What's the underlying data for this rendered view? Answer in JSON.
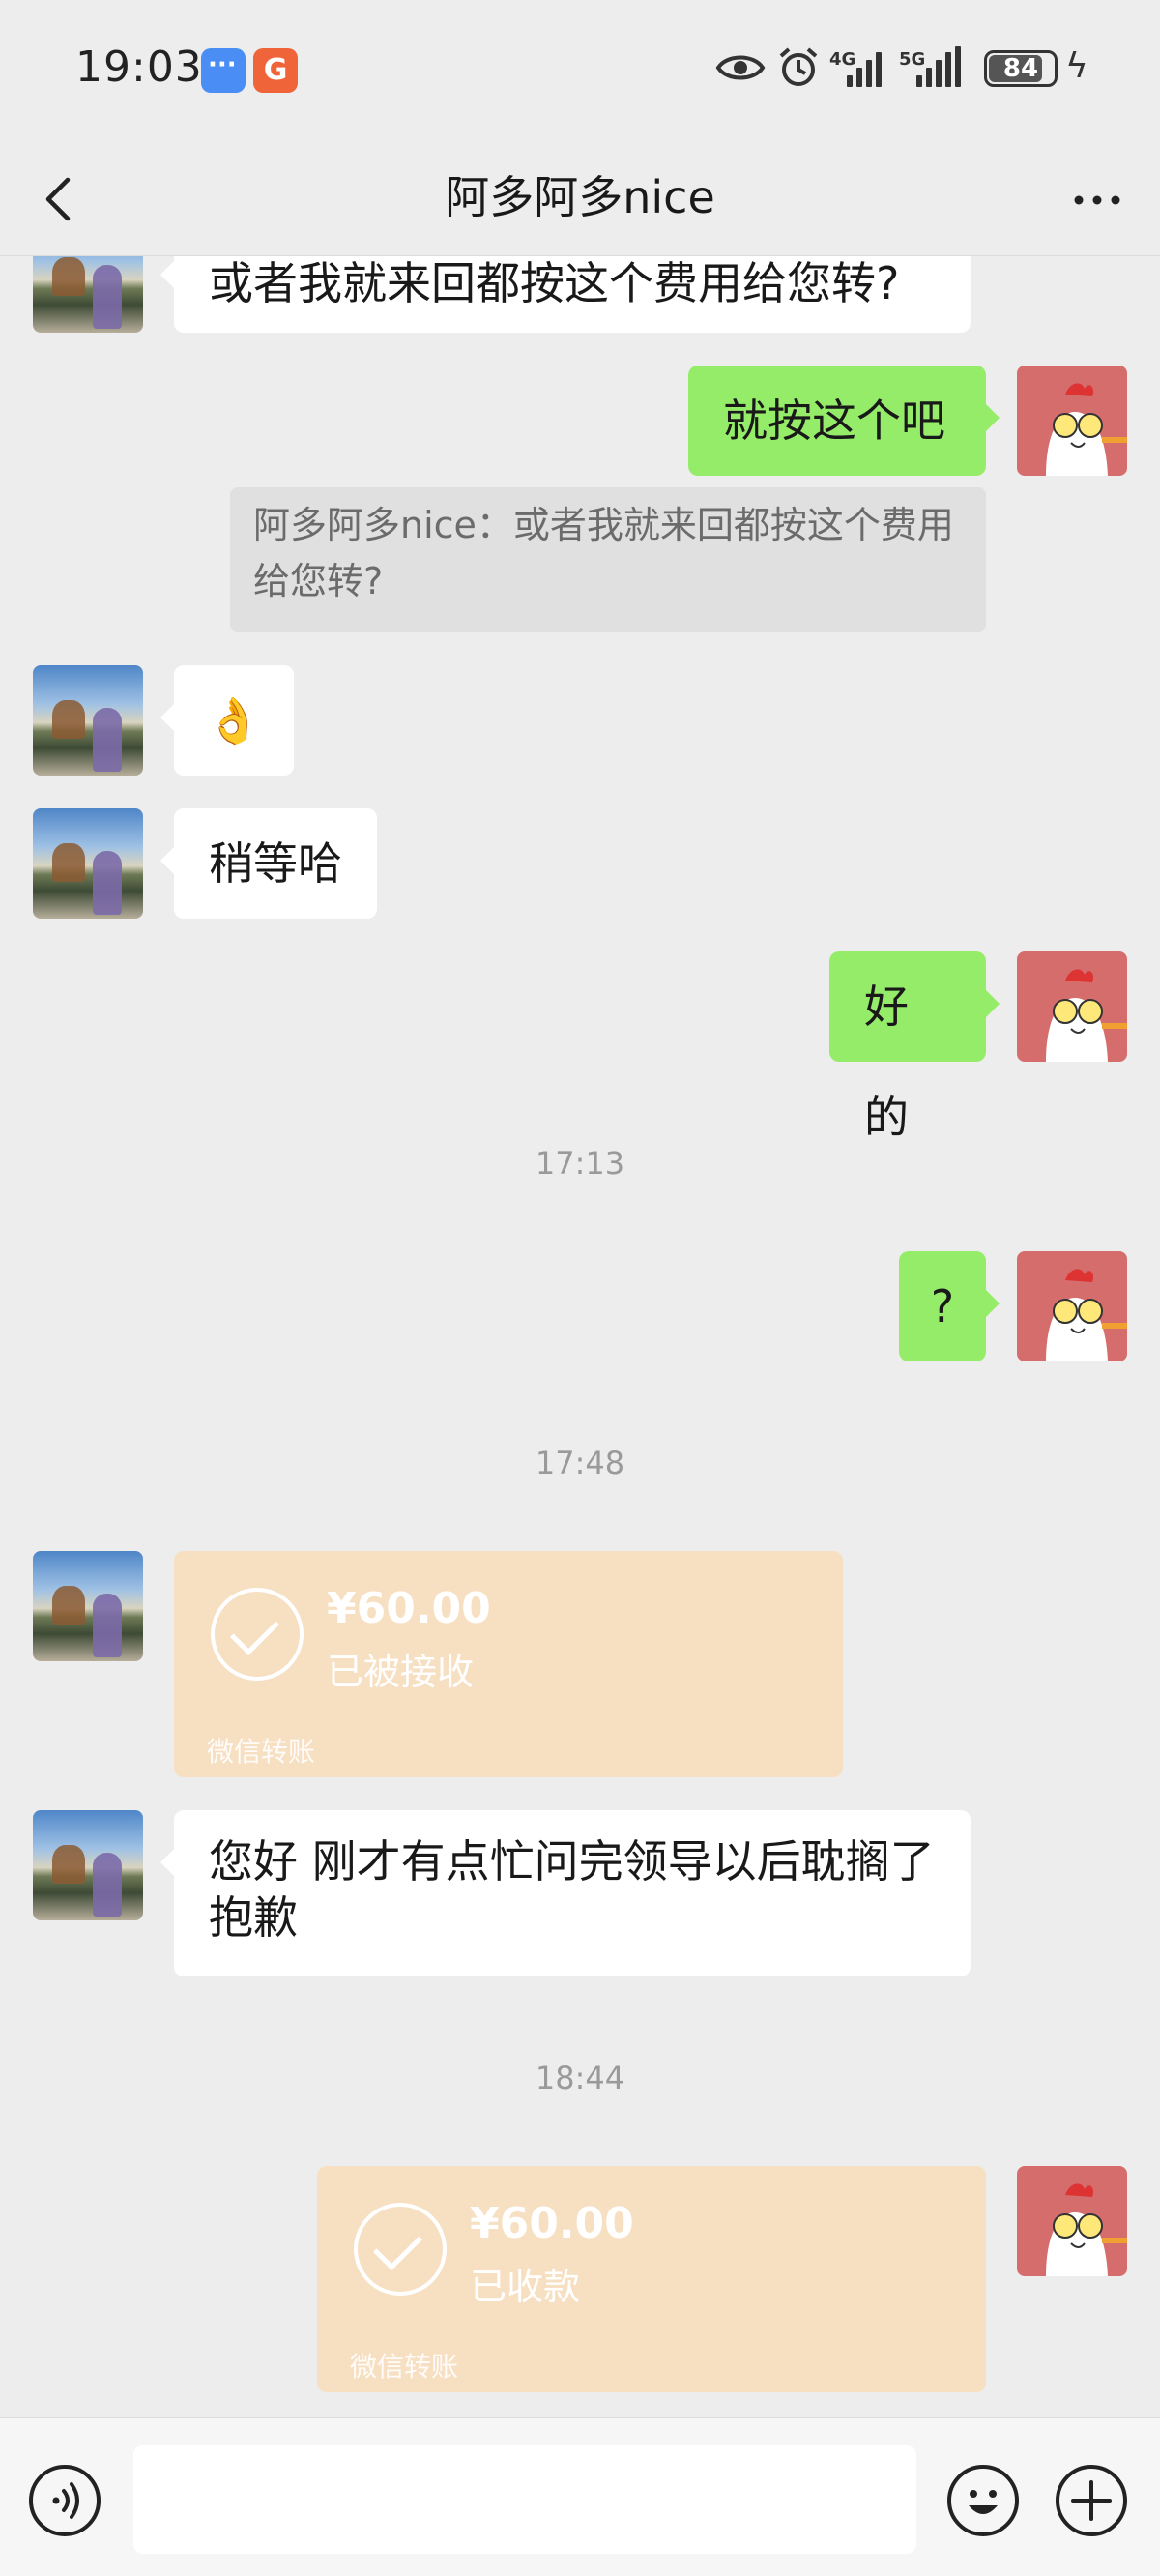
{
  "status_bar": {
    "time": "19:03",
    "app_badge": "G",
    "net1": "4G",
    "net2": "5G",
    "battery": "84",
    "battery_level": 0.84
  },
  "header": {
    "title": "阿多阿多nice"
  },
  "messages": {
    "m1": "或者我就来回都按这个费用给您转?",
    "m2": "就按这个吧",
    "quote": "阿多阿多nice：或者我就来回都按这个费用给您转?",
    "m3": "👌",
    "m4": "稍等哈",
    "m5": "好的",
    "time1": "17:13",
    "m6": "?",
    "time2": "17:48",
    "transfer1": {
      "amount": "¥60.00",
      "status": "已被接收",
      "brand": "微信转账"
    },
    "m7": "您好 刚才有点忙问完领导以后耽搁了 抱歉",
    "time3": "18:44",
    "transfer2": {
      "amount": "¥60.00",
      "status": "已收款",
      "brand": "微信转账"
    }
  },
  "input": {
    "value": "",
    "placeholder": ""
  },
  "colors": {
    "bg": "#ededed",
    "outgoing": "#95ec69",
    "incoming": "#ffffff",
    "transfer": "#f7dfc2"
  },
  "icons": [
    "back-icon",
    "more-icon",
    "voice-icon",
    "emoji-icon",
    "plus-icon"
  ]
}
